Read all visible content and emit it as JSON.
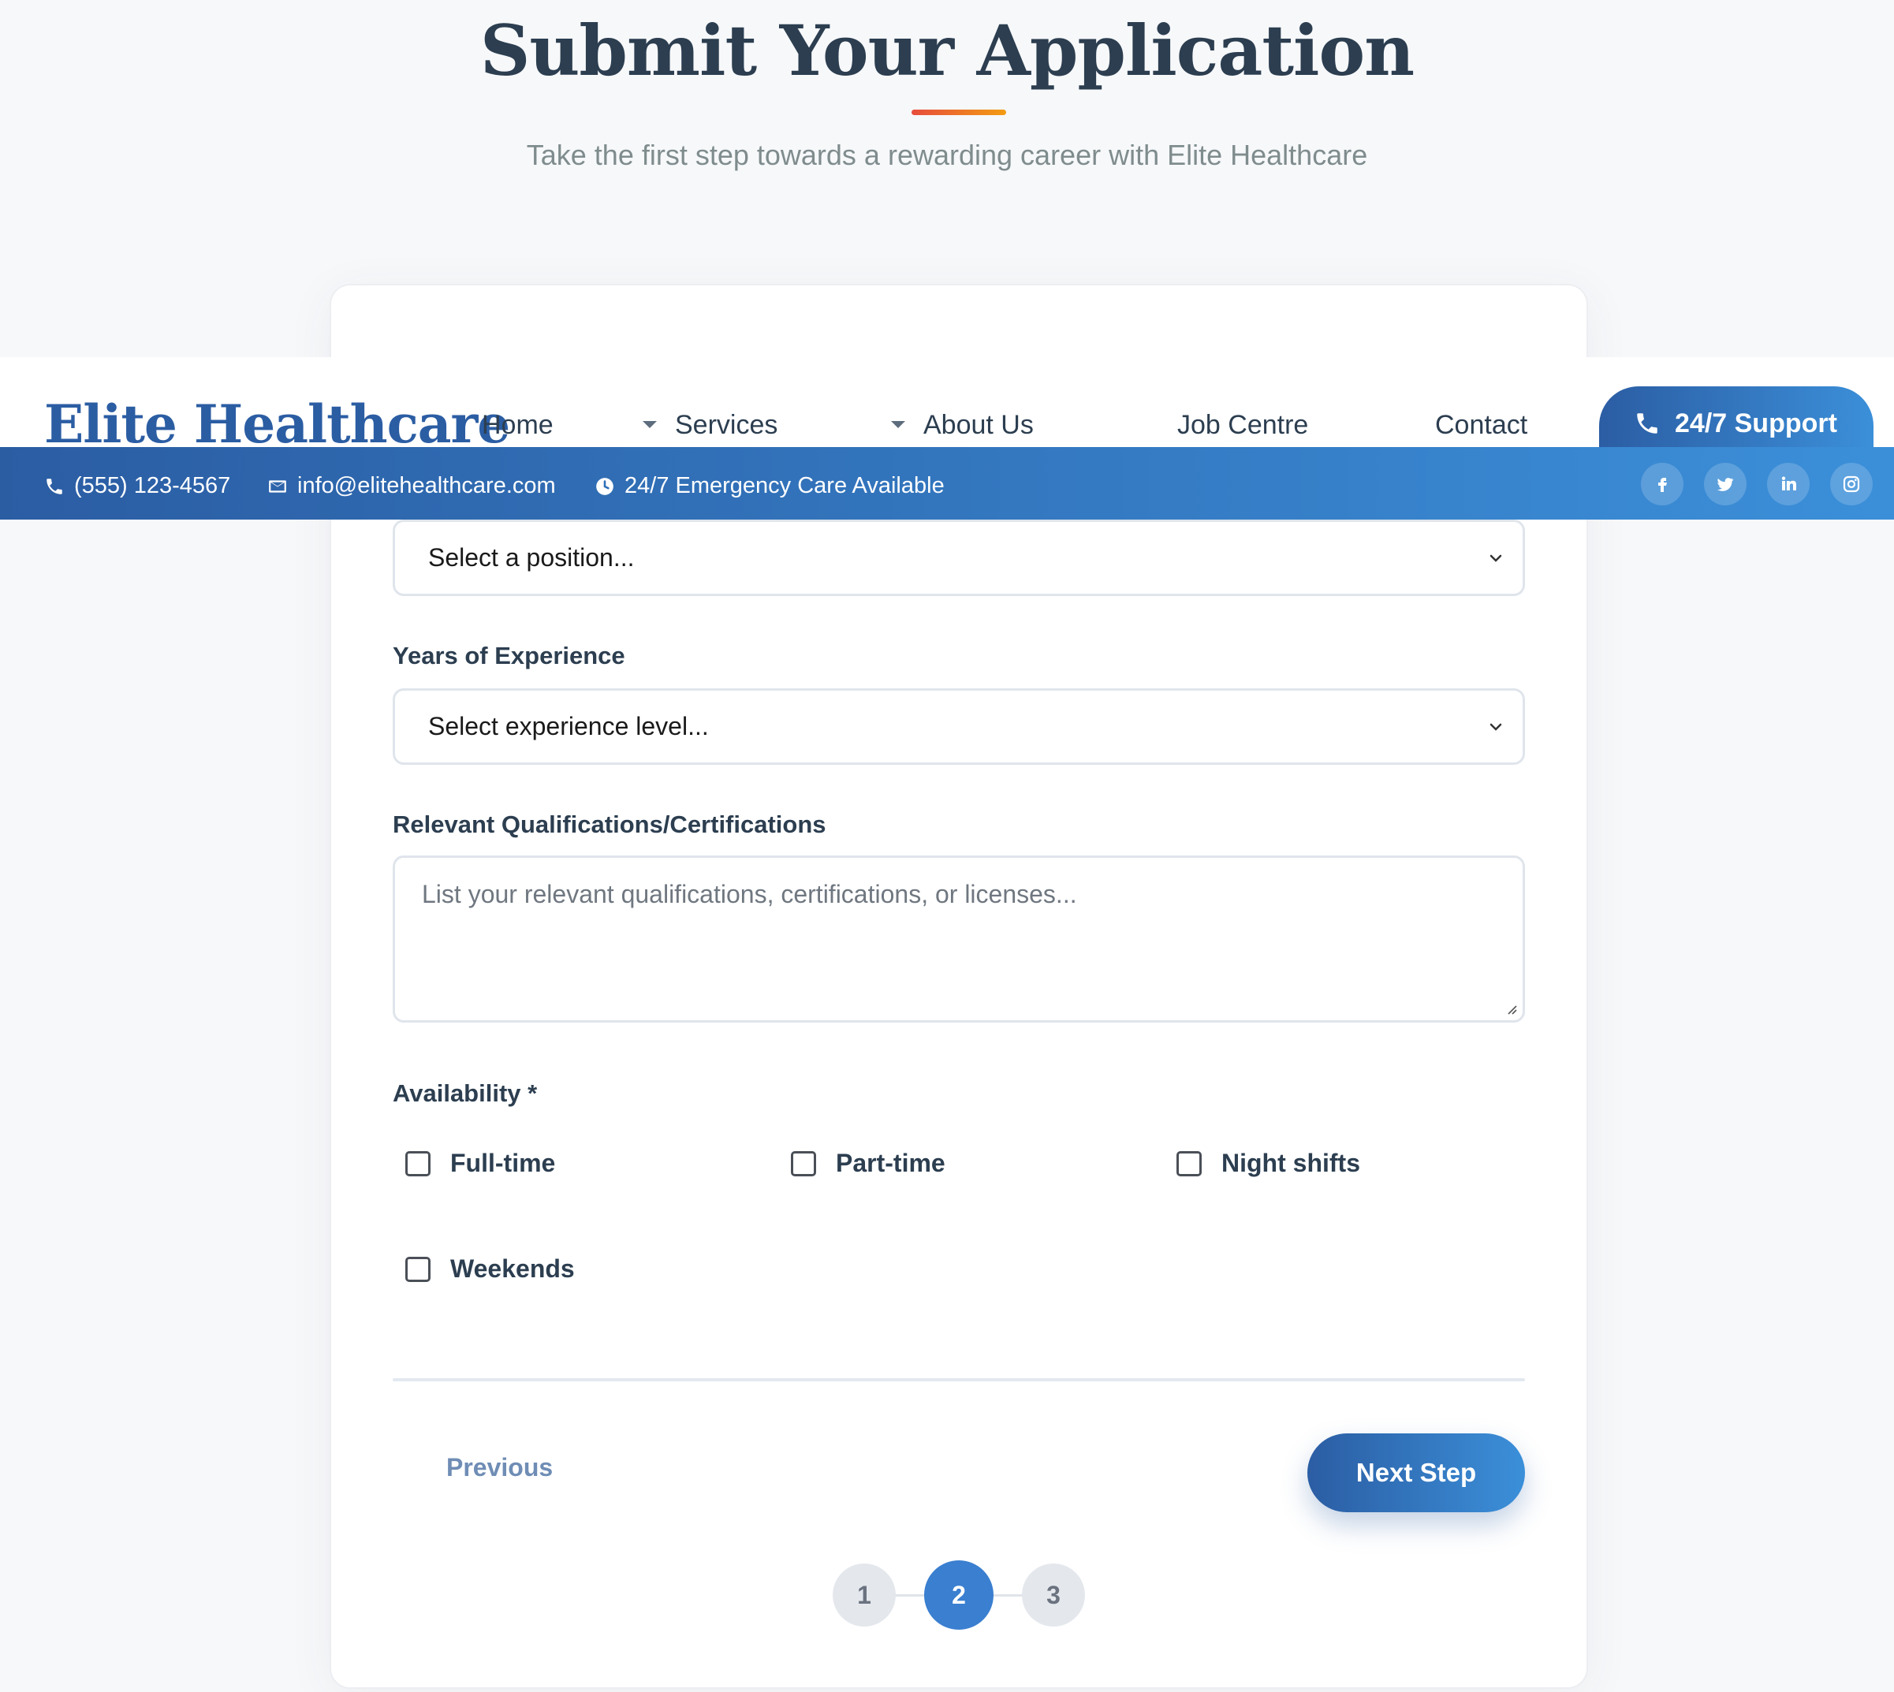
{
  "hero": {
    "title": "Submit Your Application",
    "subtitle": "Take the first step towards a rewarding career with Elite Healthcare"
  },
  "form": {
    "position_select": {
      "value": "Select a position..."
    },
    "experience": {
      "label": "Years of Experience",
      "value": "Select experience level..."
    },
    "qualifications": {
      "label": "Relevant Qualifications/Certifications",
      "placeholder": "List your relevant qualifications, certifications, or licenses..."
    },
    "availability": {
      "label": "Availability *",
      "options": [
        {
          "label": "Full-time",
          "checked": false
        },
        {
          "label": "Part-time",
          "checked": false
        },
        {
          "label": "Night shifts",
          "checked": false
        },
        {
          "label": "Weekends",
          "checked": false
        }
      ]
    },
    "previous_label": "Previous",
    "next_label": "Next Step",
    "steps": [
      "1",
      "2",
      "3"
    ],
    "current_step": 2
  },
  "header": {
    "logo": "Elite Healthcare",
    "nav": [
      "Home",
      "Services",
      "About Us",
      "Job Centre",
      "Contact"
    ],
    "support_label": "24/7 Support",
    "phone": "(555) 123-4567",
    "email": "info@elitehealthcare.com",
    "emergency": "24/7 Emergency Care Available",
    "social_icons": [
      "facebook-icon",
      "twitter-icon",
      "linkedin-icon",
      "instagram-icon"
    ]
  },
  "colors": {
    "brand_blue": "#2b5da3",
    "brand_blue_light": "#3b8fd9",
    "accent_red": "#e74c3c",
    "accent_orange": "#f39c12",
    "text_dark": "#2c3e50"
  }
}
